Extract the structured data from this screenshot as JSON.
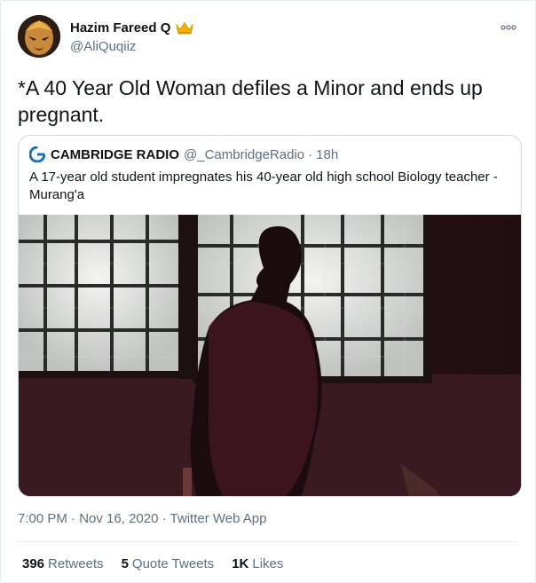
{
  "tweet": {
    "author": {
      "display_name": "Hazim Fareed Q",
      "handle": "@AliQuqiiz",
      "badge_icon": "crown-icon"
    },
    "text": "*A 40 Year Old Woman defiles a Minor and ends up pregnant.",
    "timestamp": "7:00 PM",
    "separator": "·",
    "date": "Nov 16, 2020",
    "source": "Twitter Web App",
    "stats": {
      "retweets": {
        "count": "396",
        "label": "Retweets"
      },
      "quote_tweets": {
        "count": "5",
        "label": "Quote Tweets"
      },
      "likes": {
        "count": "1K",
        "label": "Likes"
      }
    }
  },
  "quoted": {
    "name": "CAMBRIDGE RADIO",
    "handle": "@_CambridgeRadio",
    "separator": "·",
    "time": "18h",
    "text": "A 17-year old student impregnates his 40-year old high school Biology teacher - Murang'a"
  },
  "colors": {
    "text": "#0f1419",
    "muted": "#5b7083",
    "border": "#cfd9de",
    "accent": "#1da1f2"
  }
}
